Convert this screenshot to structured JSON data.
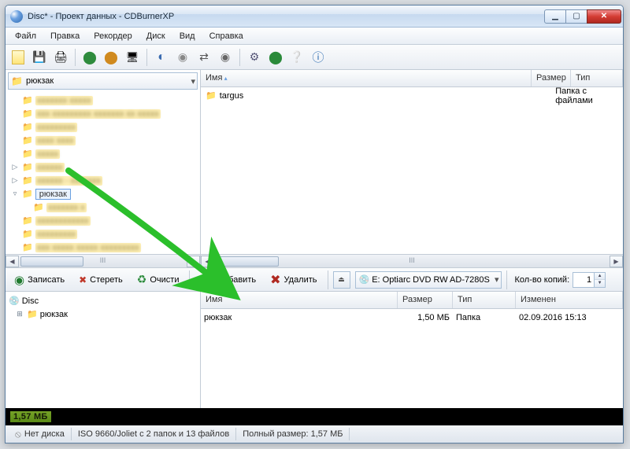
{
  "title": "Disc* - Проект данных - CDBurnerXP",
  "menu": {
    "file": "Файл",
    "edit": "Правка",
    "recorder": "Рекордер",
    "disc": "Диск",
    "view": "Вид",
    "help": "Справка"
  },
  "folder_dropdown": "рюкзак",
  "upper_cols": {
    "name": "Имя",
    "size": "Размер",
    "type": "Тип"
  },
  "upper_file": {
    "name": "targus",
    "type": "Папка с файлами"
  },
  "tree_selected": "рюкзак",
  "action": {
    "burn": "Записать",
    "erase": "Стереть",
    "clear": "Очисти",
    "add": "Добавить",
    "delete": "Удалить",
    "copies_label": "Кол-во копий:",
    "copies_value": "1"
  },
  "drive": "E: Optiarc DVD RW AD-7280S",
  "lower_tree": {
    "root": "Disc",
    "item": "рюкзак"
  },
  "lower_cols": {
    "name": "Имя",
    "size": "Размер",
    "type": "Тип",
    "modified": "Изменен"
  },
  "lower_row": {
    "name": "рюкзак",
    "size": "1,50 МБ",
    "type": "Папка",
    "modified": "02.09.2016 15:13"
  },
  "sizebar": "1,57 МБ",
  "status": {
    "nodisc": "Нет диска",
    "iso": "ISO 9660/Joliet с 2 папок и 13 файлов",
    "fullsize": "Полный размер: 1,57 МБ"
  },
  "hscroll_marker": "III"
}
